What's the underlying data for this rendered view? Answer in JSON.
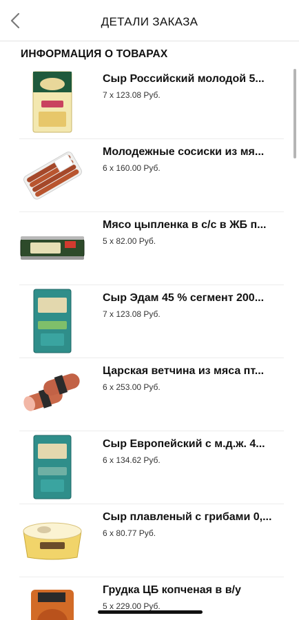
{
  "header": {
    "title": "ДЕТАЛИ ЗАКАЗА",
    "back_icon": "chevron-left-icon"
  },
  "section": {
    "title": "ИНФОРМАЦИЯ О ТОВАРАХ"
  },
  "items": [
    {
      "name": "Сыр Российский молодой 5...",
      "qty": "7 x 123.08 Руб.",
      "image": "cheese-package-icon"
    },
    {
      "name": "Молодежные сосиски из мя...",
      "qty": "6 x 160.00 Руб.",
      "image": "sausages-package-icon"
    },
    {
      "name": "Мясо цыпленка в с/с в ЖБ п...",
      "qty": "5 x 82.00 Руб.",
      "image": "canned-chicken-icon"
    },
    {
      "name": "Сыр Эдам 45 % сегмент 200...",
      "qty": "7 x 123.08 Руб.",
      "image": "cheese-package-icon"
    },
    {
      "name": "Царская  ветчина из мяса пт...",
      "qty": "6 x 253.00 Руб.",
      "image": "ham-icon"
    },
    {
      "name": "Сыр Европейский  с м.д.ж. 4...",
      "qty": "6 x 134.62 Руб.",
      "image": "cheese-package-icon"
    },
    {
      "name": "Сыр плавленый с грибами 0,...",
      "qty": "6 x 80.77 Руб.",
      "image": "processed-cheese-tub-icon"
    },
    {
      "name": "Грудка ЦБ копченая в в/у",
      "qty": "5 x 229.00 Руб.",
      "image": "smoked-breast-icon"
    }
  ]
}
